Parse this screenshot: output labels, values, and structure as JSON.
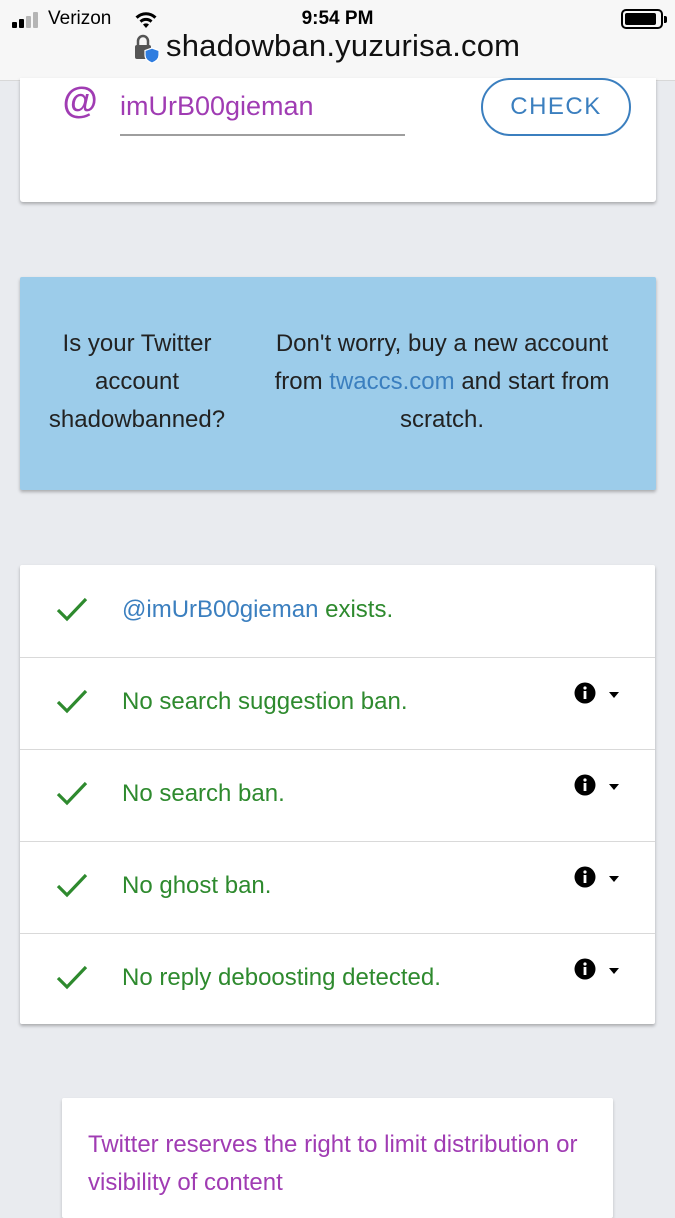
{
  "status_bar": {
    "carrier": "Verizon",
    "time": "9:54 PM",
    "battery_level": 0.9,
    "signal_bars": 2
  },
  "browser": {
    "url": "shadowban.yuzurisa.com"
  },
  "search": {
    "at_symbol": "@",
    "username": "imUrB00gieman",
    "check_label": "CHECK"
  },
  "ad": {
    "left_text": "Is your Twitter account shadowbanned?",
    "right_prefix": "Don't worry, buy a new account from",
    "right_link": "twaccs.com",
    "right_suffix": "and start from scratch."
  },
  "results": [
    {
      "handle": "@imUrB00gieman",
      "text": "exists.",
      "has_info": false
    },
    {
      "handle": "",
      "text": "No search suggestion ban.",
      "has_info": true
    },
    {
      "handle": "",
      "text": "No search ban.",
      "has_info": true
    },
    {
      "handle": "",
      "text": "No ghost ban.",
      "has_info": true
    },
    {
      "handle": "",
      "text": "No reply deboosting detected.",
      "has_info": true
    }
  ],
  "notice": {
    "text": "Twitter reserves the right to limit distribution or visibility of content"
  },
  "colors": {
    "accent_purple": "#a03cb3",
    "link_blue": "#3b7fbf",
    "success_green": "#2e8a2e",
    "ad_background": "#9cccea"
  },
  "icons": {
    "result_check": "check-icon",
    "info": "info-icon",
    "expand": "caret-down-icon",
    "lock": "lock-shield-icon",
    "wifi": "wifi-icon"
  }
}
